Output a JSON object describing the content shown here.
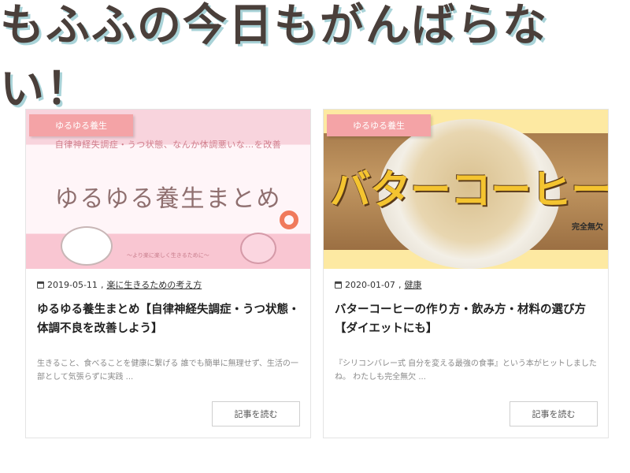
{
  "site": {
    "title": "もふふの今日もがんばらない！"
  },
  "posts": [
    {
      "category_badge": "ゆるゆる養生",
      "thumbnail": {
        "subtitle": "自律神経失調症・うつ状態、なんか体調悪いな…を改善",
        "big_text": "ゆるゆる養生まとめ",
        "caption": "〜より楽に楽しく生きるために〜"
      },
      "date": "2019-05-11",
      "category_link": "楽に生きるための考え方",
      "title": "ゆるゆる養生まとめ【自律神経失調症・うつ状態・体調不良を改善しよう】",
      "excerpt": "生きること、食べることを健康に繋げる 誰でも簡単に無理せず、生活の一部として気張らずに実践 ...",
      "read_more": "記事を読む"
    },
    {
      "category_badge": "ゆるゆる養生",
      "thumbnail": {
        "big_text": "バターコーヒー完全版",
        "small_text": "完全無欠"
      },
      "date": "2020-01-07",
      "category_link": "健康",
      "title": "バターコーヒーの作り方・飲み方・材料の選び方【ダイエットにも】",
      "excerpt": "『シリコンバレー式 自分を変える最強の食事』という本がヒットしましたね。 わたしも完全無欠 ...",
      "read_more": "記事を読む"
    }
  ],
  "colors": {
    "badge": "#f4a3a6",
    "title_text": "#4a3f3a",
    "title_outline": "#a9d3d8"
  },
  "icons": {
    "date": "calendar-icon"
  }
}
